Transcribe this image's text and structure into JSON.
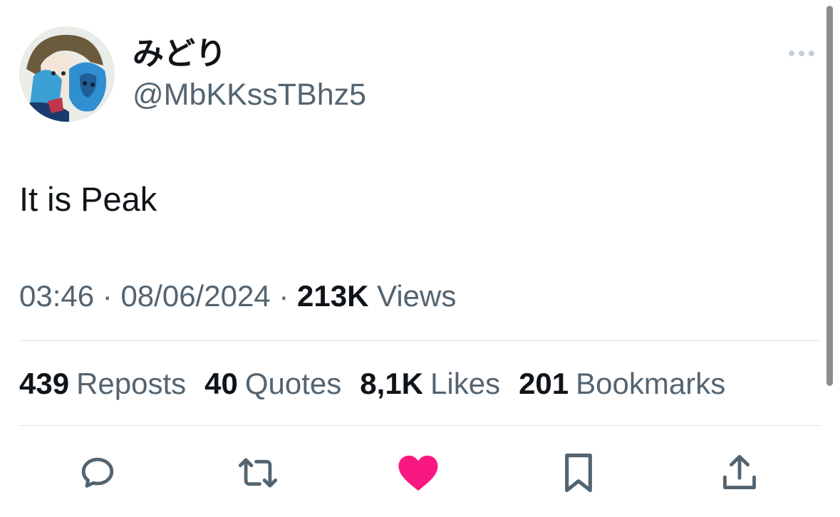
{
  "author": {
    "display_name": "みどり",
    "handle": "@MbKKssTBhz5",
    "avatar_icon": "anime-avatar-image"
  },
  "tweet": {
    "text": "It is Peak",
    "time": "03:46",
    "date": "08/06/2024",
    "separator": "·",
    "views_count": "213K",
    "views_label": "Views"
  },
  "stats": {
    "reposts_count": "439",
    "reposts_label": "Reposts",
    "quotes_count": "40",
    "quotes_label": "Quotes",
    "likes_count": "8,1K",
    "likes_label": "Likes",
    "bookmarks_count": "201",
    "bookmarks_label": "Bookmarks"
  },
  "actions": {
    "reply_icon": "speech-bubble-icon",
    "repost_icon": "repost-arrows-icon",
    "like_icon": "heart-icon",
    "bookmark_icon": "bookmark-icon",
    "share_icon": "share-upload-icon"
  },
  "colors": {
    "text_primary": "#0f1419",
    "text_secondary": "#536471",
    "like_active": "#f91880",
    "icon_gray": "#536471"
  }
}
